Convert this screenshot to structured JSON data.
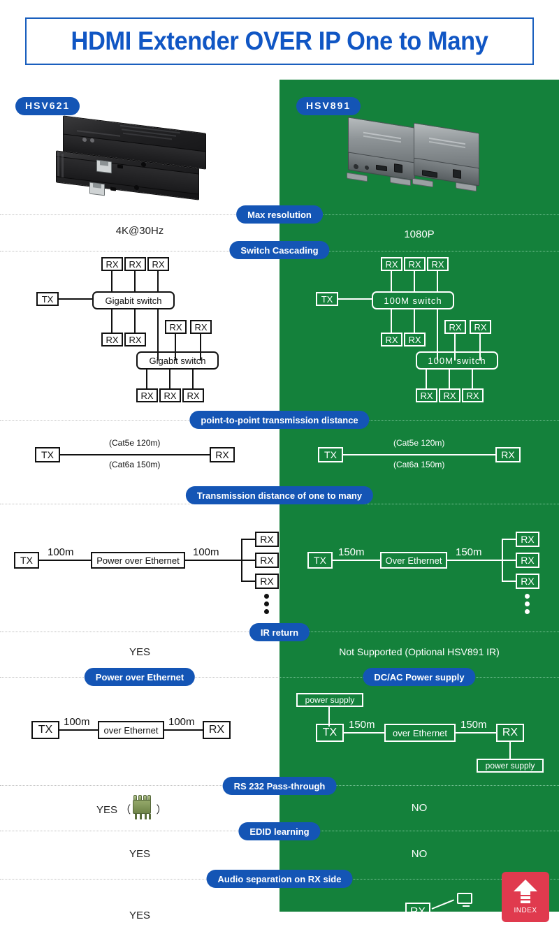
{
  "title": "HDMI Extender OVER IP One to Many",
  "products": {
    "left": {
      "badge": "HSV621",
      "photo_alt": "hsv621-product-photo"
    },
    "right": {
      "badge": "HSV891",
      "photo_alt": "hsv891-product-photo"
    }
  },
  "sections": [
    {
      "label": "Max resolution",
      "left_value": "4K@30Hz",
      "right_value": "1080P"
    },
    {
      "label": "Switch Cascading",
      "left_value": "",
      "right_value": ""
    },
    {
      "label": "point-to-point transmission distance",
      "left_value": "",
      "right_value": ""
    },
    {
      "label": "Transmission distance of one to many",
      "left_value": "",
      "right_value": ""
    },
    {
      "label": "IR return",
      "left_value": "YES",
      "right_value": "Not Supported (Optional HSV891 IR)"
    },
    {
      "label": "Power over Ethernet",
      "label_right": "DC/AC Power supply",
      "left_value": "",
      "right_value": ""
    },
    {
      "label": "RS 232 Pass-through",
      "left_value": "YES",
      "left_value_suffix_open": "（",
      "left_value_suffix_close": "）",
      "right_value": "NO"
    },
    {
      "label": "EDID learning",
      "left_value": "YES",
      "right_value": "NO"
    },
    {
      "label": "Audio separation on RX side",
      "left_value": "YES",
      "right_value": ""
    }
  ],
  "cascade": {
    "left": {
      "tx": "TX",
      "switch1": "Gigabit switch",
      "switch2": "Gigabit switch",
      "rx": "RX"
    },
    "right": {
      "tx": "TX",
      "switch1": "100M switch",
      "switch2": "100M switch",
      "rx": "RX"
    }
  },
  "p2p": {
    "left": {
      "tx": "TX",
      "rx": "RX",
      "cat5e": "(Cat5e 120m)",
      "cat6a": "(Cat6a  150m)"
    },
    "right": {
      "tx": "TX",
      "rx": "RX",
      "cat5e": "(Cat5e 120m)",
      "cat6a": "(Cat6a  150m)"
    }
  },
  "one_to_many": {
    "left": {
      "tx": "TX",
      "d1": "100m",
      "mid": "Power over Ethernet",
      "d2": "100m",
      "rx": "RX"
    },
    "right": {
      "tx": "TX",
      "d1": "150m",
      "mid": "Over Ethernet",
      "d2": "150m",
      "rx": "RX"
    }
  },
  "power": {
    "left": {
      "tx": "TX",
      "d1": "100m",
      "mid": "over Ethernet",
      "d2": "100m",
      "rx": "RX"
    },
    "right": {
      "tx": "TX",
      "d1": "150m",
      "mid": "over Ethernet",
      "d2": "150m",
      "rx": "RX",
      "psu_top": "power supply",
      "psu_bottom": "power supply"
    }
  },
  "audio": {
    "rx": "RX"
  },
  "index_button": {
    "label": "INDEX"
  },
  "colors": {
    "brand_blue": "#1455b5",
    "title_blue": "#1056c4",
    "panel_green": "#14813b",
    "index_red": "#e03a4e",
    "white": "#ffffff"
  }
}
